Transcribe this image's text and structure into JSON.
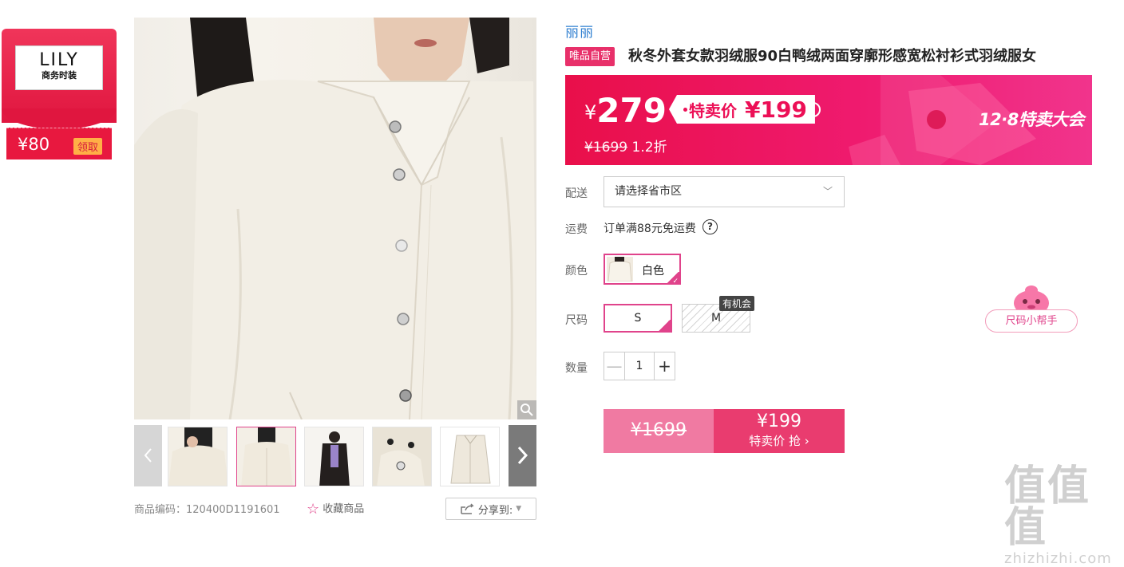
{
  "brand_card": {
    "logo_main": "LILY",
    "logo_sub": "商务时装",
    "coupon_value": "¥80",
    "coupon_claim": "领取"
  },
  "gallery": {
    "thumbnail_count": 5,
    "active_thumbnail": 2
  },
  "product": {
    "brand": "丽丽",
    "vip_badge": "唯品自营",
    "title": "秋冬外套女款羽绒服90白鸭绒两面穿廓形感宽松衬衫式羽绒服女",
    "sku_label": "商品编码：",
    "sku_code": "120400D1191601",
    "favorite_label": "收藏商品",
    "share_label": "分享到:"
  },
  "price": {
    "yen": "¥",
    "current": "279",
    "special_label": "特卖价",
    "special_price": "¥199",
    "original": "¥1699",
    "discount": "1.2折",
    "event_title": "12·8特卖大会",
    "info_icon": "i"
  },
  "delivery": {
    "label": "配送",
    "placeholder": "请选择省市区"
  },
  "freight": {
    "label": "运费",
    "text": "订单满88元免运费",
    "help_icon": "?"
  },
  "color": {
    "label": "颜色",
    "options": [
      {
        "name": "白色",
        "selected": true
      }
    ]
  },
  "size": {
    "label": "尺码",
    "options": [
      {
        "name": "S",
        "selected": true,
        "available": true
      },
      {
        "name": "M",
        "selected": false,
        "available": false
      }
    ],
    "chance_tip": "有机会",
    "helper": "尺码小帮手"
  },
  "quantity": {
    "label": "数量",
    "value": "1",
    "minus": "—",
    "plus": "+"
  },
  "buy": {
    "original": "¥1699",
    "price": "¥199",
    "action": "特卖价 抢 ›"
  },
  "watermark": {
    "logo": "值值值",
    "text": "zhizhizhi.com"
  },
  "colors": {
    "accent_pink": "#e0438b",
    "banner_red": "#e90f4a",
    "buy_pink": "#e93c6f",
    "brand_blue": "#2f7fd0"
  }
}
